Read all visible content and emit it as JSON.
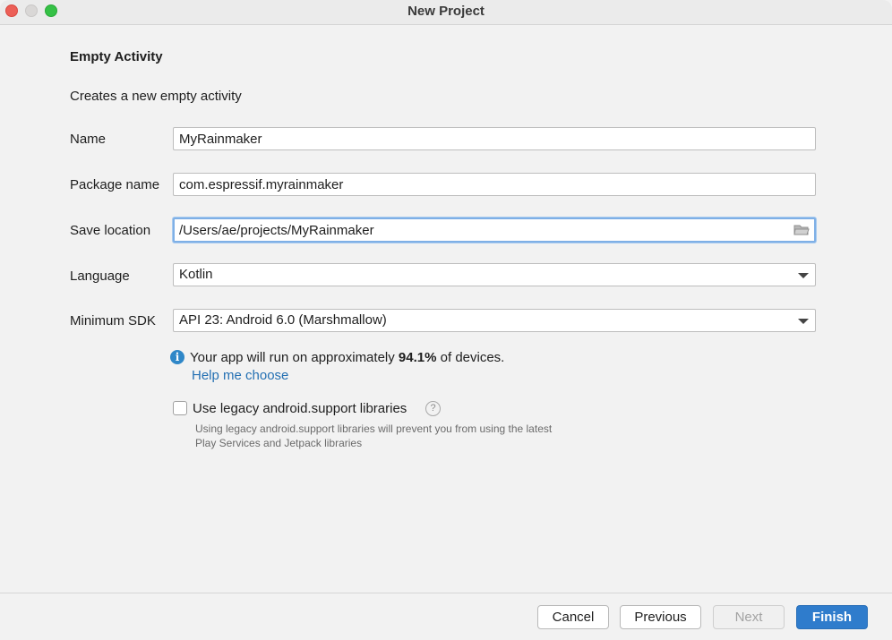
{
  "window": {
    "title": "New Project"
  },
  "template": {
    "heading": "Empty Activity",
    "description": "Creates a new empty activity"
  },
  "form": {
    "name": {
      "label": "Name",
      "value": "MyRainmaker"
    },
    "package": {
      "label": "Package name",
      "value": "com.espressif.myrainmaker"
    },
    "location": {
      "label": "Save location",
      "value": "/Users/ae/projects/MyRainmaker"
    },
    "language": {
      "label": "Language",
      "value": "Kotlin"
    },
    "min_sdk": {
      "label": "Minimum SDK",
      "value": "API 23: Android 6.0 (Marshmallow)"
    }
  },
  "info": {
    "prefix": "Your app will run on approximately ",
    "percent": "94.1%",
    "suffix": " of devices.",
    "help_link": "Help me choose"
  },
  "legacy": {
    "label": "Use legacy android.support libraries",
    "checked": false,
    "note": "Using legacy android.support libraries will prevent you from using the latest Play Services and Jetpack libraries"
  },
  "buttons": {
    "cancel": "Cancel",
    "previous": "Previous",
    "next": "Next",
    "finish": "Finish"
  },
  "colors": {
    "accent": "#2f7ccc",
    "link": "#2470b3",
    "info_icon": "#2f87c8"
  }
}
